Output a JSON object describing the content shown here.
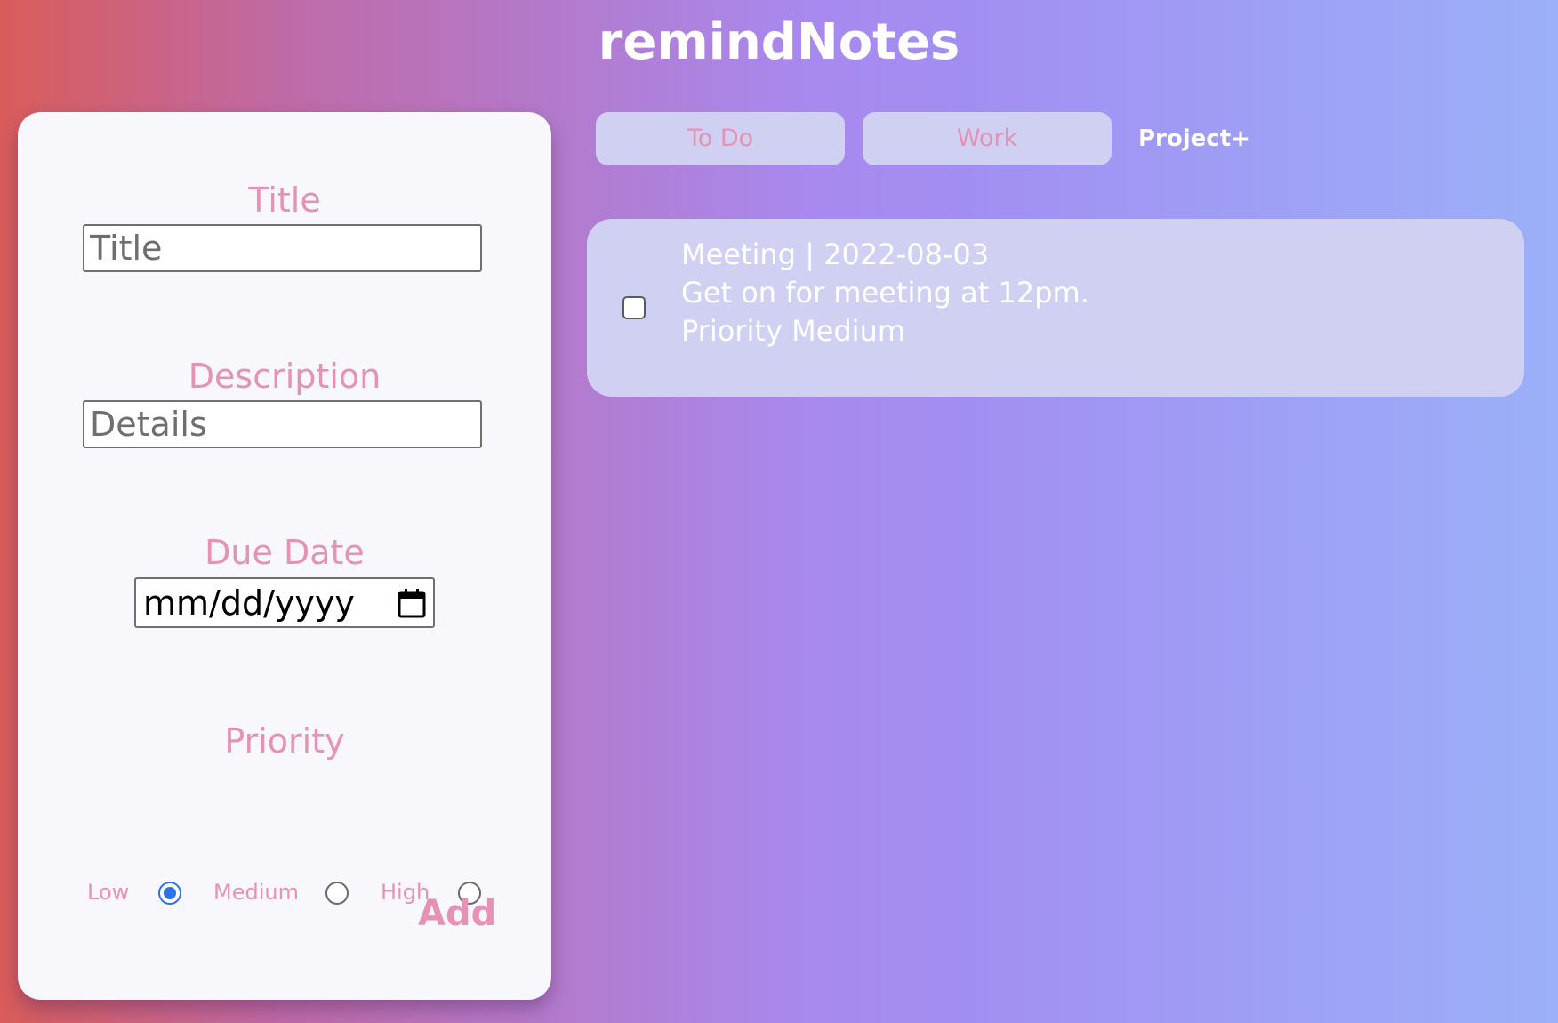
{
  "app": {
    "title": "remindNotes"
  },
  "form": {
    "title_label": "Title",
    "title_placeholder": "Title",
    "description_label": "Description",
    "description_placeholder": "Details",
    "due_date_label": "Due Date",
    "due_date_placeholder": "mm/dd/yyyy",
    "priority_label": "Priority",
    "priority_options": [
      {
        "label": "Low",
        "selected": true
      },
      {
        "label": "Medium",
        "selected": false
      },
      {
        "label": "High",
        "selected": false
      }
    ],
    "add_label": "Add"
  },
  "tabs": [
    {
      "label": "To Do"
    },
    {
      "label": "Work"
    }
  ],
  "add_project_label": "Project+",
  "notes": [
    {
      "heading": "Meeting | 2022-08-03",
      "description": "Get on for meeting at 12pm.",
      "priority": "Priority Medium",
      "checked": false
    }
  ],
  "colors": {
    "accent_pink": "#e692b6",
    "radio_blue": "#2f72e8",
    "card_lavender": "#d0d0f3"
  }
}
